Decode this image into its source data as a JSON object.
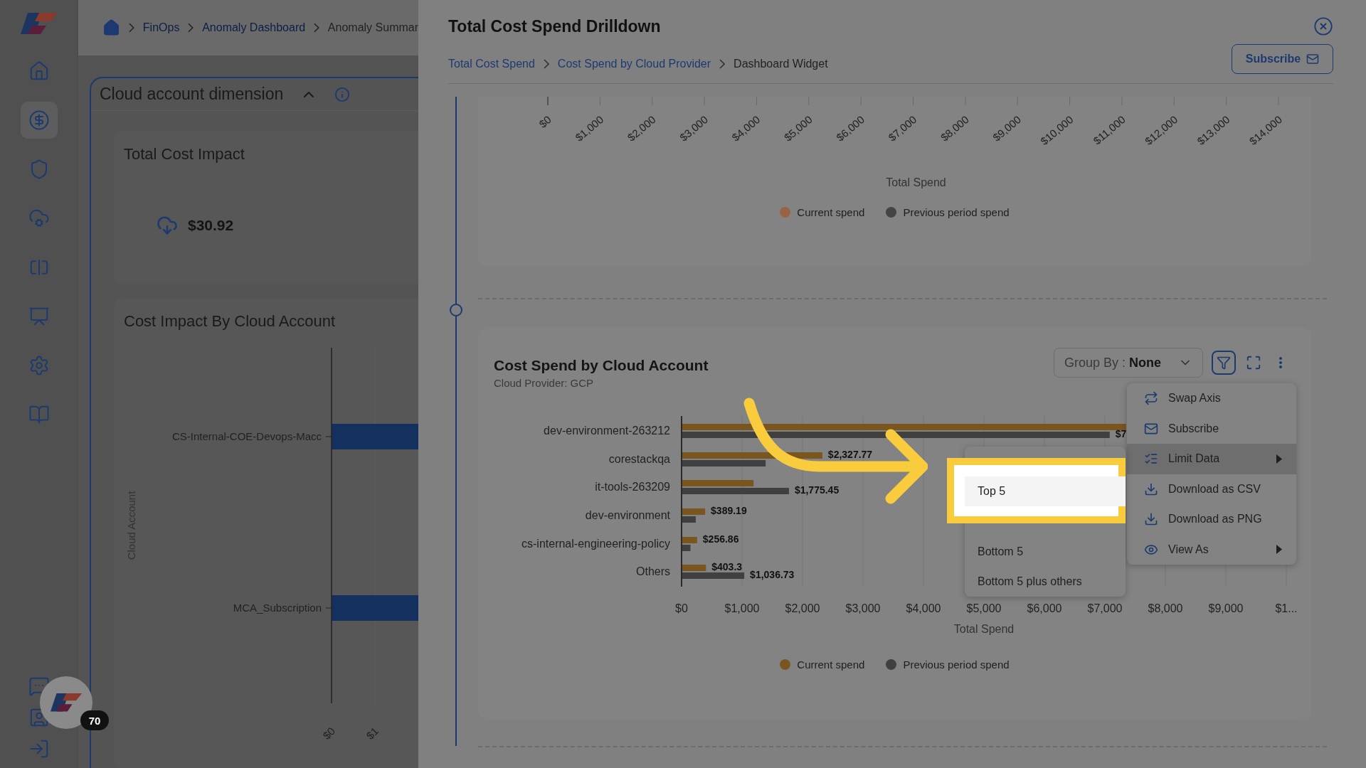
{
  "sidebar": {
    "items": [
      {
        "selected": false
      },
      {
        "selected": true
      },
      {
        "selected": false
      },
      {
        "selected": false
      },
      {
        "selected": false
      },
      {
        "selected": false
      },
      {
        "selected": false
      },
      {
        "selected": false
      }
    ],
    "assistant_badge": "70"
  },
  "background_page": {
    "breadcrumb": [
      "FinOps",
      "Anomaly Dashboard",
      "Anomaly Summar"
    ],
    "panel": {
      "title": "Cloud account dimension",
      "expanded": true
    },
    "total_cost_impact": {
      "title": "Total Cost Impact",
      "value": "$30.92"
    },
    "cost_impact_chart": {
      "title": "Cost Impact By Cloud Account",
      "ylabel": "Cloud Account",
      "categories": [
        "CS-Internal-COE-Devops-Macc",
        "MCA_Subscription"
      ],
      "xticks": [
        "$0",
        "$1"
      ]
    }
  },
  "drawer": {
    "title": "Total Cost Spend Drilldown",
    "breadcrumb": [
      {
        "label": "Total Cost Spend",
        "link": true
      },
      {
        "label": "Cost Spend by Cloud Provider",
        "link": true
      },
      {
        "label": "Dashboard Widget",
        "link": false
      }
    ],
    "subscribe_button": "Subscribe",
    "previous_widget": {
      "xticks": [
        "$0",
        "$1,000",
        "$2,000",
        "$3,000",
        "$4,000",
        "$5,000",
        "$6,000",
        "$7,000",
        "$8,000",
        "$9,000",
        "$10,000",
        "$11,000",
        "$12,000",
        "$13,000",
        "$14,000"
      ],
      "xlabel": "Total Spend",
      "legend": [
        {
          "label": "Current spend",
          "color": "#9a6244"
        },
        {
          "label": "Previous period spend",
          "color": "#444444"
        }
      ]
    },
    "widget": {
      "title": "Cost Spend by Cloud Account",
      "subtitle": "Cloud Provider: GCP",
      "group_by": {
        "label": "Group By :",
        "value": "None"
      },
      "chart_data": {
        "type": "bar",
        "orientation": "horizontal",
        "grid": true,
        "xlabel": "Total Spend",
        "xlim": [
          0,
          10000
        ],
        "categories": [
          "dev-environment-263212",
          "corestackqa",
          "it-tools-263209",
          "dev-environment",
          "cs-internal-engineering-policy",
          "Others"
        ],
        "series": [
          {
            "name": "Current spend",
            "color": "#7b5520",
            "values": [
              7350,
              2327.77,
              1190,
              389.19,
              256.86,
              403.3
            ]
          },
          {
            "name": "Previous period spend",
            "color": "#404040",
            "values": [
              7080,
              1390,
              1775.45,
              235,
              147,
              1036.73
            ]
          }
        ],
        "xticks": [
          {
            "value": 0,
            "label": "$0"
          },
          {
            "value": 1000,
            "label": "$1,000"
          },
          {
            "value": 2000,
            "label": "$2,000"
          },
          {
            "value": 3000,
            "label": "$3,000"
          },
          {
            "value": 4000,
            "label": "$4,000"
          },
          {
            "value": 5000,
            "label": "$5,000"
          },
          {
            "value": 6000,
            "label": "$6,000"
          },
          {
            "value": 7000,
            "label": "$7,000"
          },
          {
            "value": 8000,
            "label": "$8,000"
          },
          {
            "value": 9000,
            "label": "$9,000"
          },
          {
            "value": 10000,
            "label": "$1..."
          }
        ],
        "value_labels": [
          [
            null,
            "$2,327.77",
            null,
            "$389.19",
            "$256.86",
            "$403.3"
          ],
          [
            "$7",
            null,
            "$1,775.45",
            null,
            null,
            "$1,036.73"
          ]
        ]
      },
      "menu": [
        {
          "label": "Swap Axis",
          "submenu": false,
          "selected": false
        },
        {
          "label": "Subscribe",
          "submenu": false,
          "selected": false
        },
        {
          "label": "Limit Data",
          "submenu": true,
          "selected": true
        },
        {
          "label": "Download as CSV",
          "submenu": false,
          "selected": false
        },
        {
          "label": "Download as PNG",
          "submenu": false,
          "selected": false
        },
        {
          "label": "View As",
          "submenu": true,
          "selected": false
        }
      ],
      "limit_menu": [
        {
          "label": "Top 5",
          "selected": true
        },
        {
          "label": "Bottom 5",
          "selected": false
        },
        {
          "label": "Bottom 5 plus others",
          "selected": false
        }
      ]
    }
  }
}
